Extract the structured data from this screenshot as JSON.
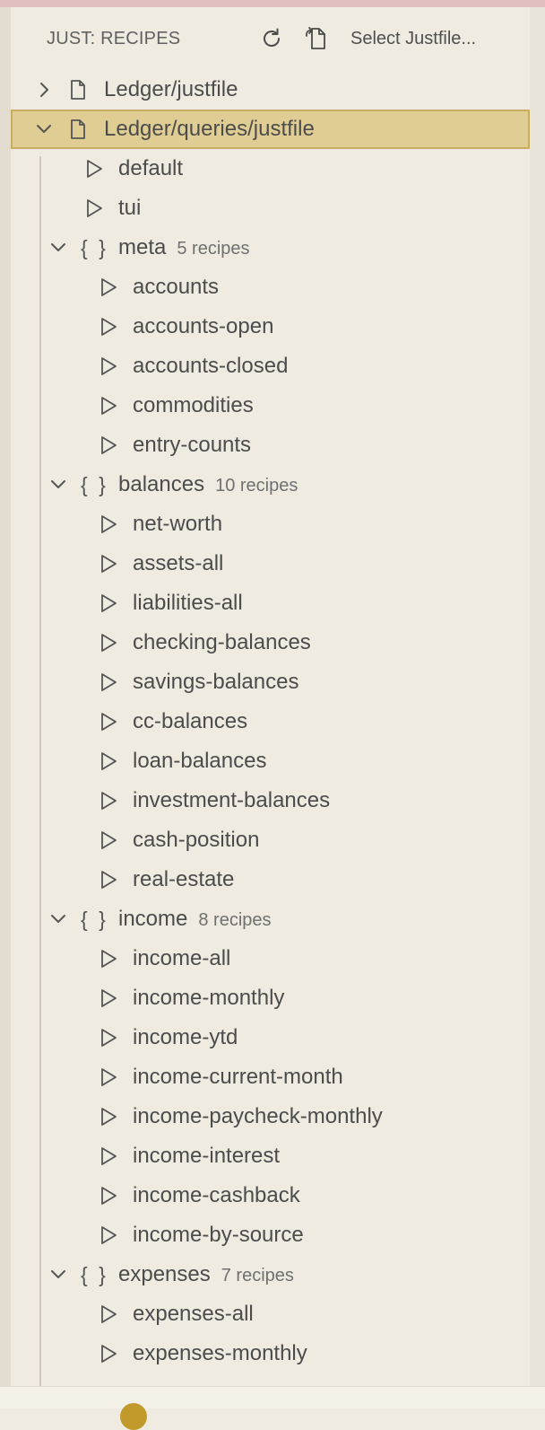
{
  "header": {
    "title": "JUST: RECIPES",
    "refresh_icon": "refresh-icon",
    "select_file_icon": "file-swap-icon",
    "select_link": "Select Justfile..."
  },
  "colors": {
    "panel_bg": "#efebe0",
    "selection_bg": "#dfcd93",
    "selection_border": "#c9ae62",
    "top_strip": "#e2bfbf"
  },
  "tree": {
    "files": [
      {
        "label": "Ledger/justfile",
        "expanded": false
      },
      {
        "label": "Ledger/queries/justfile",
        "expanded": true,
        "selected": true
      }
    ],
    "top_recipes": [
      "default",
      "tui"
    ],
    "groups": [
      {
        "name": "meta",
        "count": "5 recipes",
        "recipes": [
          "accounts",
          "accounts-open",
          "accounts-closed",
          "commodities",
          "entry-counts"
        ]
      },
      {
        "name": "balances",
        "count": "10 recipes",
        "recipes": [
          "net-worth",
          "assets-all",
          "liabilities-all",
          "checking-balances",
          "savings-balances",
          "cc-balances",
          "loan-balances",
          "investment-balances",
          "cash-position",
          "real-estate"
        ]
      },
      {
        "name": "income",
        "count": "8 recipes",
        "recipes": [
          "income-all",
          "income-monthly",
          "income-ytd",
          "income-current-month",
          "income-paycheck-monthly",
          "income-interest",
          "income-cashback",
          "income-by-source"
        ]
      },
      {
        "name": "expenses",
        "count": "7 recipes",
        "recipes": [
          "expenses-all",
          "expenses-monthly"
        ]
      }
    ]
  }
}
